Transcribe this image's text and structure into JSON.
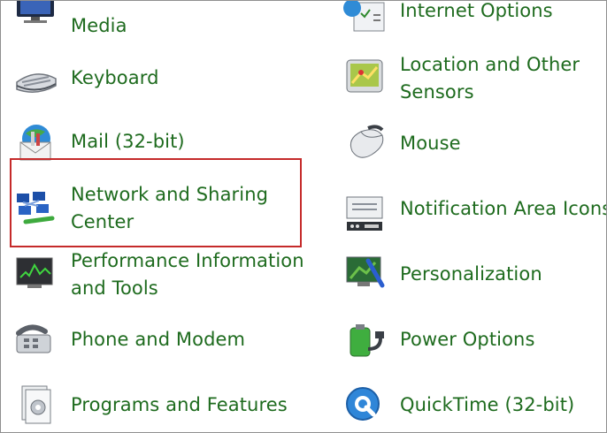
{
  "control_panel": {
    "left_column": [
      {
        "label": "Media",
        "icon": "media-center-icon"
      },
      {
        "label": "Keyboard",
        "icon": "keyboard-icon"
      },
      {
        "label": "Mail (32-bit)",
        "icon": "mail-icon"
      },
      {
        "label_line1": "Network and Sharing",
        "label_line2": "Center",
        "icon": "network-sharing-icon"
      },
      {
        "label_line1": "Performance Information",
        "label_line2": "and Tools",
        "icon": "performance-icon"
      },
      {
        "label": "Phone and Modem",
        "icon": "phone-modem-icon"
      },
      {
        "label": "Programs and Features",
        "icon": "programs-features-icon"
      }
    ],
    "right_column": [
      {
        "label": "Internet Options",
        "icon": "internet-options-icon"
      },
      {
        "label_line1": "Location and Other",
        "label_line2": "Sensors",
        "icon": "location-sensors-icon"
      },
      {
        "label": "Mouse",
        "icon": "mouse-icon"
      },
      {
        "label": "Notification Area Icons",
        "icon": "notification-area-icon"
      },
      {
        "label": "Personalization",
        "icon": "personalization-icon"
      },
      {
        "label": "Power Options",
        "icon": "power-options-icon"
      },
      {
        "label": "QuickTime (32-bit)",
        "icon": "quicktime-icon"
      }
    ]
  },
  "colors": {
    "link_text": "#1e6b1e",
    "highlight_border": "#c52a2a",
    "frame_border": "#8f8f8f"
  }
}
